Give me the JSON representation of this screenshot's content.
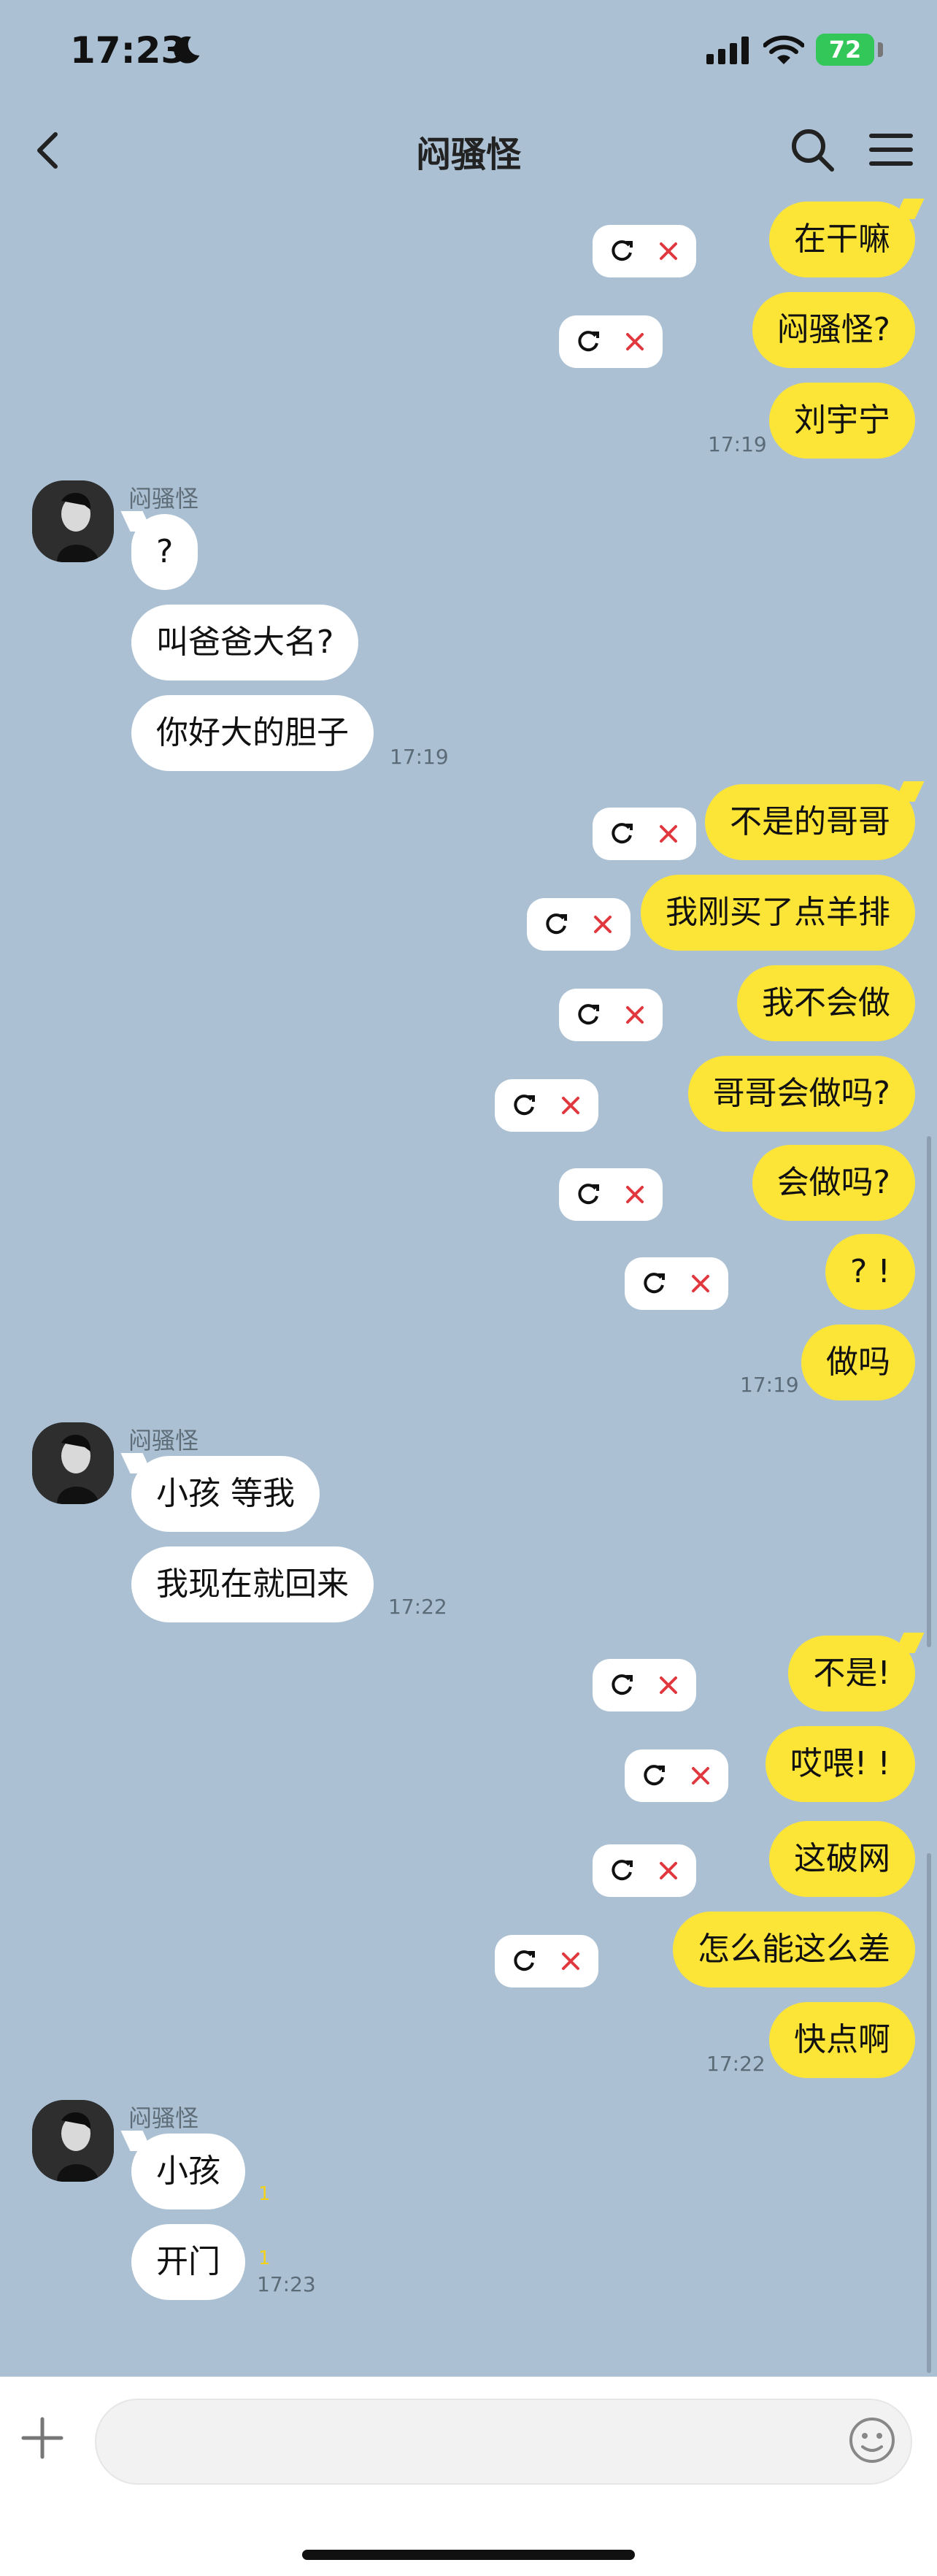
{
  "status_bar": {
    "time": "17:23",
    "battery": "72"
  },
  "header": {
    "title": "闷骚怪"
  },
  "contact": {
    "name": "闷骚怪"
  },
  "messages": {
    "m1": "在干嘛",
    "m2": "闷骚怪?",
    "m3": "刘宇宁",
    "t1": "17:19",
    "m4": "?",
    "m5": "叫爸爸大名?",
    "m6": "你好大的胆子",
    "t2": "17:19",
    "m7": "不是的哥哥",
    "m8": "我刚买了点羊排",
    "m9": "我不会做",
    "m10": "哥哥会做吗?",
    "m11": "会做吗?",
    "m12": "? !",
    "m13": "做吗",
    "t3": "17:19",
    "m14": "小孩 等我",
    "m15": "我现在就回来",
    "t4": "17:22",
    "m16": "不是!",
    "m17": "哎喂! !",
    "m18": "这破网",
    "m19": "怎么能这么差",
    "m20": "快点啊",
    "t5": "17:22",
    "m21": "小孩",
    "m22": "开门",
    "u1": "1",
    "u2": "1",
    "t6": "17:23"
  },
  "input": {
    "placeholder": ""
  },
  "icons": [
    "back-icon",
    "search-icon",
    "menu-icon",
    "retry-icon",
    "delete-icon",
    "plus-icon",
    "emoji-icon",
    "moon-icon",
    "signal-icon",
    "wifi-icon"
  ],
  "colors": {
    "background": "#abc0d3",
    "my_bubble": "#fde537",
    "their_bubble": "#ffffff",
    "delete_x": "#e0383e",
    "battery": "#33c759"
  }
}
